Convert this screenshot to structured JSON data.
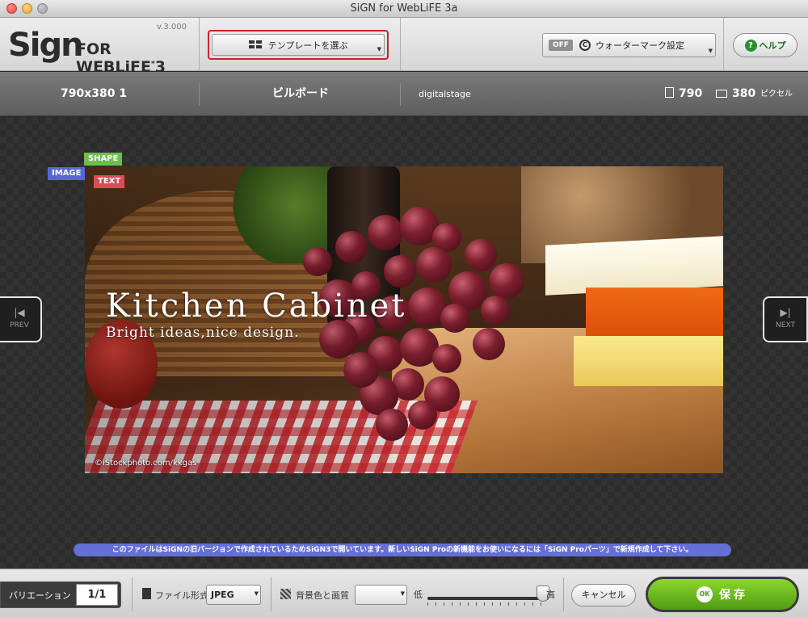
{
  "window": {
    "title": "SiGN for WebLiFE 3a"
  },
  "brand": {
    "logo": "Sign FOR WEBLiFE 3",
    "version": "v.3.000"
  },
  "toolbar": {
    "template_button": "テンプレートを選ぶ",
    "watermark_off": "OFF",
    "watermark_label": "ウォーターマーク設定",
    "help_label": "ヘルプ"
  },
  "info": {
    "size_variant": "790x380 1",
    "category": "ビルボード",
    "author": "digitalstage",
    "width": "790",
    "height": "380",
    "unit": "ピクセル"
  },
  "canvas": {
    "tags": {
      "shape": "SHAPE",
      "image": "IMAGE",
      "text": "TEXT"
    },
    "banner": {
      "title": "Kitchen Cabinet",
      "subtitle": "Bright ideas,nice design.",
      "credit": "©iStockphoto.com/kkgas"
    },
    "prev_label": "PREV",
    "next_label": "NEXT",
    "notice": "このファイルはSiGNの旧バージョンで作成されているためSiGN3で開いています。新しいSiGN Proの新機能をお使いになるには「SiGN Proパーツ」で新規作成して下さい。"
  },
  "bottom": {
    "variation_label": "バリエーション",
    "variation_value": "1/1",
    "format_label": "ファイル形式",
    "format_value": "JPEG",
    "bg_quality_label": "背景色と画質",
    "bg_color_value": "",
    "quality_low": "低",
    "quality_high": "高",
    "quality_level": 0.95,
    "cancel_label": "キャンセル",
    "ok_badge": "OK",
    "save_label": "保存"
  },
  "colors": {
    "template_highlight": "#c6262b",
    "save_green": "#6cc320",
    "notice_blue": "#6470d6",
    "tag_shape": "#6cc04a",
    "tag_image": "#5867d6",
    "tag_text": "#e04a57"
  }
}
